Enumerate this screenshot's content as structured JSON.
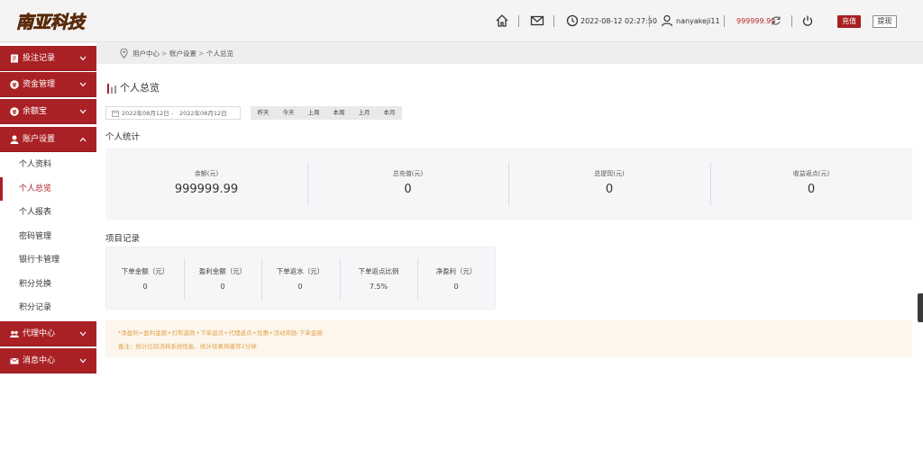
{
  "header": {
    "logo_alt": "南亚科技",
    "datetime": "2022-08-12 02:27:50",
    "username": "nanyakeji11",
    "balance": "999999.99",
    "recharge_label": "充值",
    "withdraw_label": "提现",
    "icons": [
      "home-icon",
      "mail-icon",
      "clock-icon",
      "user-icon",
      "refresh-icon",
      "power-icon"
    ]
  },
  "sidebar": {
    "menus": [
      {
        "label": "投注记录",
        "icon": "bet-record-icon"
      },
      {
        "label": "资金管理",
        "icon": "yen-circle-icon"
      },
      {
        "label": "余额宝",
        "icon": "yen-circle-icon"
      },
      {
        "label": "账户设置",
        "icon": "user-icon"
      },
      {
        "label": "代理中心",
        "icon": "group-icon"
      },
      {
        "label": "消息中心",
        "icon": "mail-icon"
      }
    ],
    "sub_items": [
      "个人资料",
      "个人总览",
      "个人报表",
      "密码管理",
      "银行卡管理",
      "积分兑换",
      "积分记录"
    ],
    "active_sub": "个人总览"
  },
  "breadcrumb": [
    "用户中心",
    "账户设置",
    "个人总览"
  ],
  "page_title": "个人总览",
  "filter": {
    "start_date": "2022年08月12日",
    "separator": "-",
    "end_date": "2022年08月12日",
    "quick": [
      "昨天",
      "今天",
      "上周",
      "本周",
      "上月",
      "本月"
    ]
  },
  "personal_stats": {
    "title": "个人统计",
    "items": [
      {
        "label": "余额(元)",
        "value": "999999.99"
      },
      {
        "label": "总充值(元)",
        "value": "0"
      },
      {
        "label": "总提现(元)",
        "value": "0"
      },
      {
        "label": "收益返点(元)",
        "value": "0"
      }
    ]
  },
  "project_records": {
    "title": "项目记录",
    "items": [
      {
        "label": "下单金额（元）",
        "value": "0"
      },
      {
        "label": "盈利金额（元）",
        "value": "0"
      },
      {
        "label": "下单返水（元）",
        "value": "0"
      },
      {
        "label": "下单返点比例",
        "value": "7.5%"
      },
      {
        "label": "净盈利（元）",
        "value": "0"
      }
    ]
  },
  "notes": {
    "formula": "*净盈利=盈利金额+打和返款+下单返点+代理返点+优惠+活动奖励-下单金额",
    "remark": "备注：统计比较消耗系统性能，统计结果将缓存2分钟"
  },
  "colors": {
    "brand_red": "#aa2125",
    "note_text": "#e2a24c",
    "note_bg": "#fdf6ec",
    "panel_bg": "#f5f6f8"
  }
}
